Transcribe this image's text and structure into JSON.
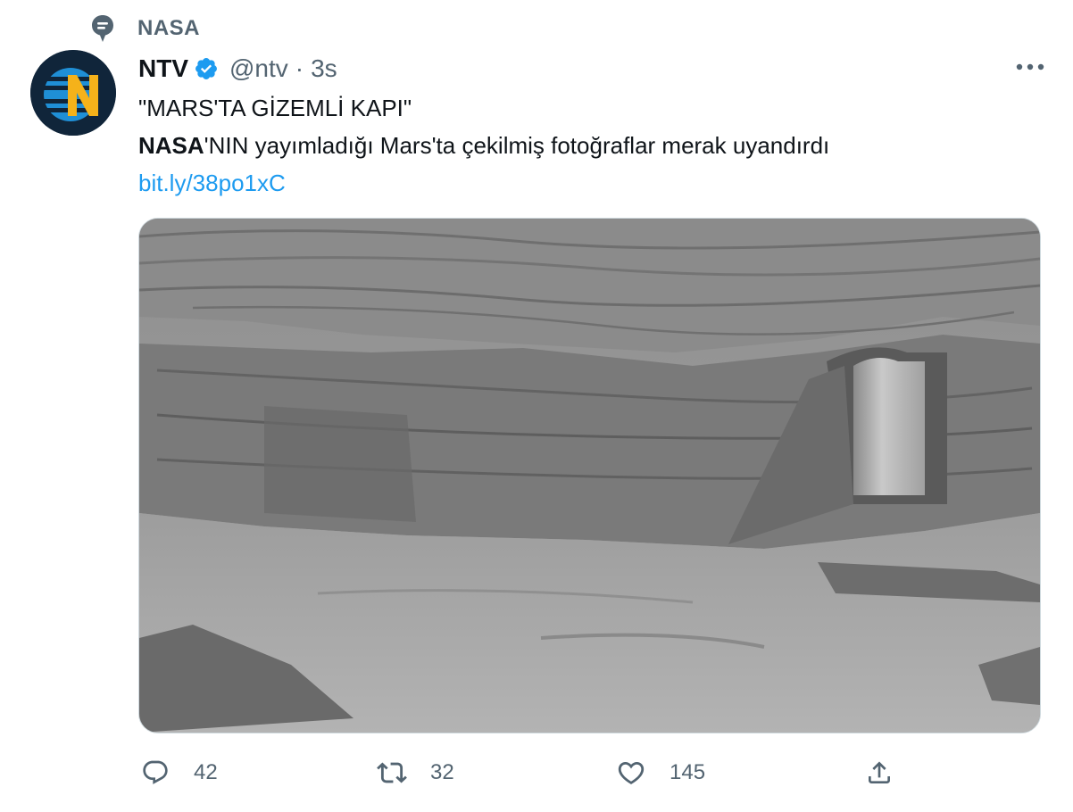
{
  "topic": {
    "icon": "topic-icon",
    "label": "NASA"
  },
  "author": {
    "avatar_icon": "ntv-logo",
    "display_name": "NTV",
    "verified_icon": "verified-badge-icon",
    "handle": "@ntv",
    "separator": "·",
    "time": "3s"
  },
  "more_icon": "more-icon",
  "tweet": {
    "line1": "\"MARS'TA GİZEMLİ KAPI\"",
    "line2_bold": "NASA",
    "line2_rest": "'NIN yayımladığı Mars'ta çekilmiş fotoğraflar merak uyandırdı",
    "link": "bit.ly/38po1xC"
  },
  "media": {
    "description_icon": "photo-image"
  },
  "actions": {
    "reply": {
      "icon": "reply-icon",
      "count": "42"
    },
    "retweet": {
      "icon": "retweet-icon",
      "count": "32"
    },
    "like": {
      "icon": "like-icon",
      "count": "145"
    },
    "share": {
      "icon": "share-icon"
    }
  },
  "colors": {
    "text": "#0f1419",
    "muted": "#536471",
    "accent": "#1d9bf0",
    "avatar_bg": "#10253a",
    "logo_blue": "#1f8fd6",
    "logo_yellow": "#f5b21a"
  }
}
